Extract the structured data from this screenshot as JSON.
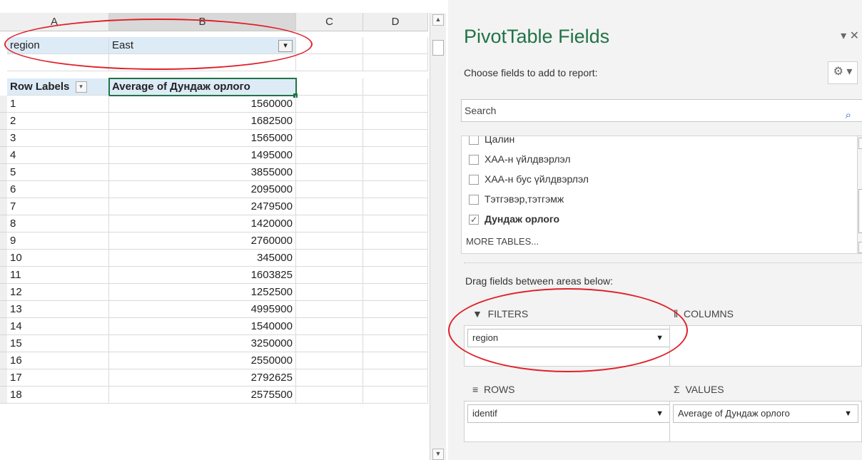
{
  "sheet": {
    "columns": [
      "A",
      "B",
      "C",
      "D"
    ],
    "filter": {
      "field": "region",
      "value": "East",
      "icon": "filter-dropdown-icon"
    },
    "headers": {
      "row_labels": "Row Labels",
      "value_header": "Average of Дундаж орлого"
    },
    "rows": [
      {
        "label": "1",
        "value": "1560000"
      },
      {
        "label": "2",
        "value": "1682500"
      },
      {
        "label": "3",
        "value": "1565000"
      },
      {
        "label": "4",
        "value": "1495000"
      },
      {
        "label": "5",
        "value": "3855000"
      },
      {
        "label": "6",
        "value": "2095000"
      },
      {
        "label": "7",
        "value": "2479500"
      },
      {
        "label": "8",
        "value": "1420000"
      },
      {
        "label": "9",
        "value": "2760000"
      },
      {
        "label": "10",
        "value": "345000"
      },
      {
        "label": "11",
        "value": "1603825"
      },
      {
        "label": "12",
        "value": "1252500"
      },
      {
        "label": "13",
        "value": "4995900"
      },
      {
        "label": "14",
        "value": "1540000"
      },
      {
        "label": "15",
        "value": "3250000"
      },
      {
        "label": "16",
        "value": "2550000"
      },
      {
        "label": "17",
        "value": "2792625"
      },
      {
        "label": "18",
        "value": "2575500"
      }
    ]
  },
  "pivot_pane": {
    "title": "PivotTable Fields",
    "subtitle": "Choose fields to add to report:",
    "search_placeholder": "Search",
    "fields": [
      {
        "label": "Цалин",
        "checked": false,
        "bold": false
      },
      {
        "label": "ХАА-н үйлдвэрлэл",
        "checked": false,
        "bold": false
      },
      {
        "label": "ХАА-н бус үйлдвэрлэл",
        "checked": false,
        "bold": false
      },
      {
        "label": "Тэтгэвэр,тэтгэмж",
        "checked": false,
        "bold": false
      },
      {
        "label": "Дундаж орлого",
        "checked": true,
        "bold": true
      }
    ],
    "more_tables": "MORE TABLES...",
    "drag_title": "Drag fields between areas below:",
    "areas": {
      "filters": {
        "title": "FILTERS",
        "field": "region"
      },
      "columns": {
        "title": "COLUMNS"
      },
      "rows": {
        "title": "ROWS",
        "field": "identif"
      },
      "values": {
        "title": "VALUES",
        "field": "Average of Дундаж орлого"
      }
    }
  },
  "colors": {
    "accent": "#217346",
    "annotation": "#e0202a",
    "filter_row": "#ddebf7"
  }
}
